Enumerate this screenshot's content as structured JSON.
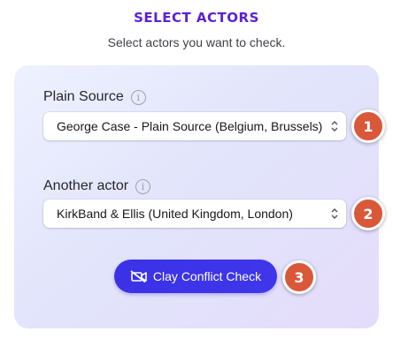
{
  "header": {
    "title": "SELECT ACTORS",
    "subtitle": "Select actors you want to check."
  },
  "form": {
    "plain_source": {
      "label": "Plain Source",
      "info_glyph": "i",
      "selected": "George Case - Plain Source (Belgium, Brussels)",
      "step": "1"
    },
    "another_actor": {
      "label": "Another actor",
      "info_glyph": "i",
      "selected": "KirkBand & Ellis (United Kingdom, London)",
      "step": "2"
    },
    "check_button": {
      "label": "Clay Conflict Check",
      "icon": "no-video-icon",
      "step": "3"
    }
  },
  "colors": {
    "title": "#5b21d6",
    "button": "#3b32e8",
    "badge": "#d9583a",
    "card_bg": "#e4e4fb"
  }
}
